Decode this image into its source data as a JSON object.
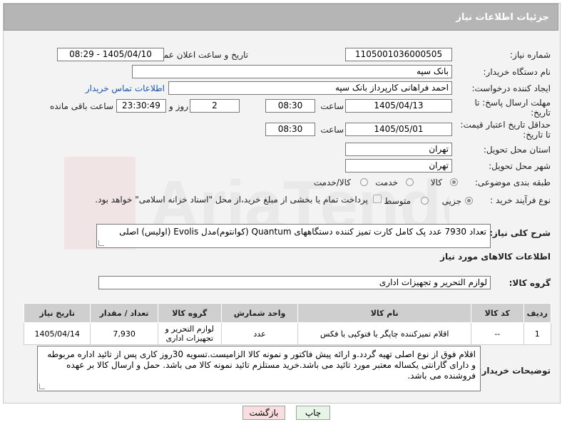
{
  "header": {
    "title": "جزئیات اطلاعات نیاز"
  },
  "fields": {
    "need_number_label": "شماره نیاز:",
    "need_number": "1105001036000505",
    "announce_label": "تاریخ و ساعت اعلان عمومی:",
    "announce_value": "1405/04/10 - 08:29",
    "buyer_org_label": "نام دستگاه خریدار:",
    "buyer_org": "بانک سپه",
    "creator_label": "ایجاد کننده درخواست:",
    "creator": "احمد فراهانی کارپرداز بانک سپه",
    "contact_link": "اطلاعات تماس خریدار",
    "deadline_label_1": "مهلت ارسال پاسخ: تا",
    "deadline_label_2": "تاریخ:",
    "deadline_date": "1405/04/13",
    "time_label": "ساعت",
    "deadline_time": "08:30",
    "days_count": "2",
    "days_label": "روز و",
    "remaining_time": "23:30:49",
    "remaining_label": "ساعت باقی مانده",
    "validity_label_1": "حداقل تاریخ اعتبار قیمت:",
    "validity_label_2": "تا تاریخ:",
    "validity_date": "1405/05/01",
    "validity_time": "08:30",
    "province_label": "استان محل تحویل:",
    "province": "تهران",
    "city_label": "شهر محل تحویل:",
    "city": "تهران",
    "category_label": "طبقه بندی موضوعی:",
    "category_options": [
      "کالا",
      "خدمت",
      "کالا/خدمت"
    ],
    "category_selected": "کالا",
    "process_label": "نوع فرآیند خرید :",
    "process_options": [
      "جزیی",
      "متوسط"
    ],
    "process_selected": "جزیی",
    "payment_note": "پرداخت تمام یا بخشی از مبلغ خرید،از محل \"اسناد خزانه اسلامی\" خواهد بود."
  },
  "description": {
    "label": "شرح کلی نیاز:",
    "text": "تعداد 7930 عدد  پک کامل کارت تمیز کننده دستگاههای Quantum (کوانتوم)مدل Evolis (اولیس) اصلی"
  },
  "goods_info": {
    "section_title": "اطلاعات کالاهای مورد نیاز",
    "group_label": "گروه کالا:",
    "group_value": "لوازم التحریر و تجهیزات اداری"
  },
  "table": {
    "headers": [
      "ردیف",
      "کد کالا",
      "نام کالا",
      "واحد شمارش",
      "گروه کالا",
      "تعداد / مقدار",
      "تاریخ نیاز"
    ],
    "rows": [
      [
        "1",
        "--",
        "اقلام تمیزکننده چاپگر یا فتوکپی یا فکس",
        "عدد",
        "لوازم التحریر و تجهیزات اداری",
        "7,930",
        "1405/04/14"
      ]
    ]
  },
  "buyer_notes": {
    "label": "توضیحات خریدار:",
    "text": "اقلام فوق از نوع اصلی تهیه گردد.و ارائه پیش فاکتور و نمونه کالا الزامیست.تسویه 30روز کاری پس از تائید اداره مربوطه و دارای گارانتی یکساله معتبر مورد تائید می باشد.خرید مستلزم تائید نمونه کالا می باشد. حمل و ارسال کالا بر عهده فروشنده می باشد."
  },
  "buttons": {
    "print": "چاپ",
    "back": "بازگشت"
  },
  "colors": {
    "header_bg": "#b5b5b5",
    "link": "#1a55b0",
    "print_bg": "#e6f5e6",
    "back_bg": "#f8dede"
  }
}
